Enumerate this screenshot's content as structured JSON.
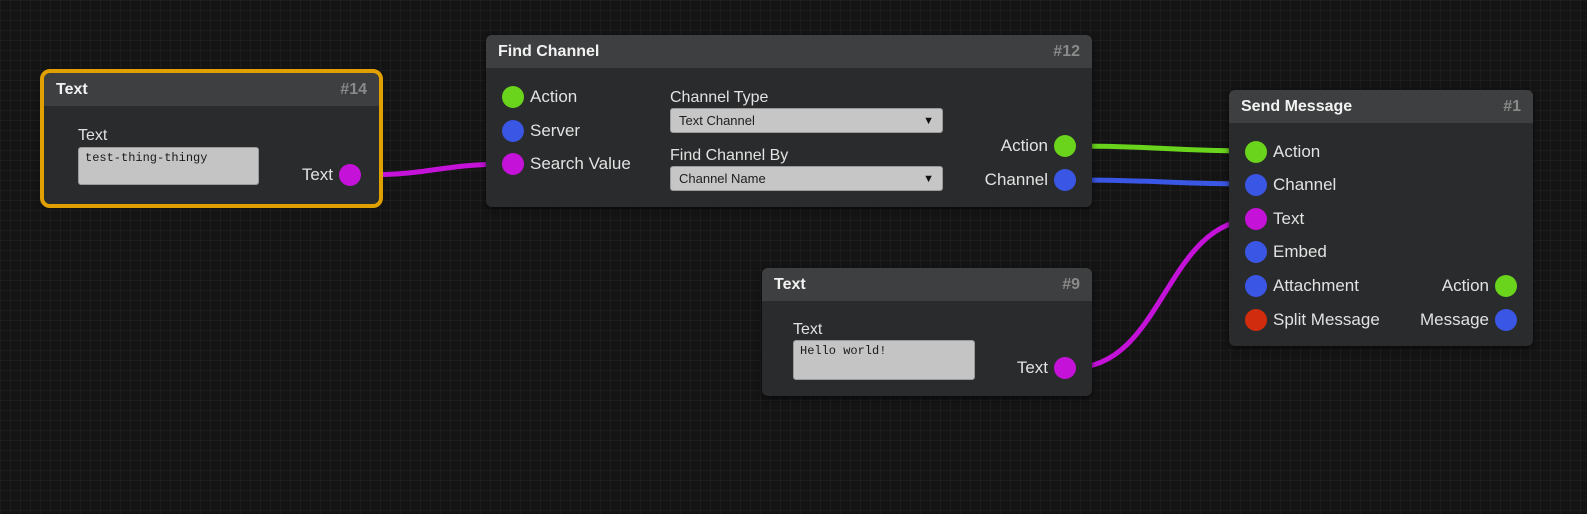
{
  "colors": {
    "action": "#6ad41c",
    "channel": "#3a56e4",
    "text": "#c412d9",
    "split": "#d22c0e",
    "selected_outline": "#e0a100"
  },
  "nodes": {
    "text14": {
      "title": "Text",
      "id": "#14",
      "field_label": "Text",
      "field_value": "test-thing-thingy",
      "outputs": {
        "text": "Text"
      }
    },
    "find_channel": {
      "title": "Find Channel",
      "id": "#12",
      "inputs": {
        "action": "Action",
        "server": "Server",
        "search_value": "Search Value"
      },
      "channel_type_label": "Channel Type",
      "channel_type_value": "Text Channel",
      "find_by_label": "Find Channel By",
      "find_by_value": "Channel Name",
      "outputs": {
        "action": "Action",
        "channel": "Channel"
      }
    },
    "text9": {
      "title": "Text",
      "id": "#9",
      "field_label": "Text",
      "field_value": "Hello world!",
      "outputs": {
        "text": "Text"
      }
    },
    "send_message": {
      "title": "Send Message",
      "id": "#1",
      "inputs": {
        "action": "Action",
        "channel": "Channel",
        "text": "Text",
        "embed": "Embed",
        "attachment": "Attachment",
        "split_message": "Split Message"
      },
      "outputs": {
        "action": "Action",
        "message": "Message"
      }
    }
  }
}
